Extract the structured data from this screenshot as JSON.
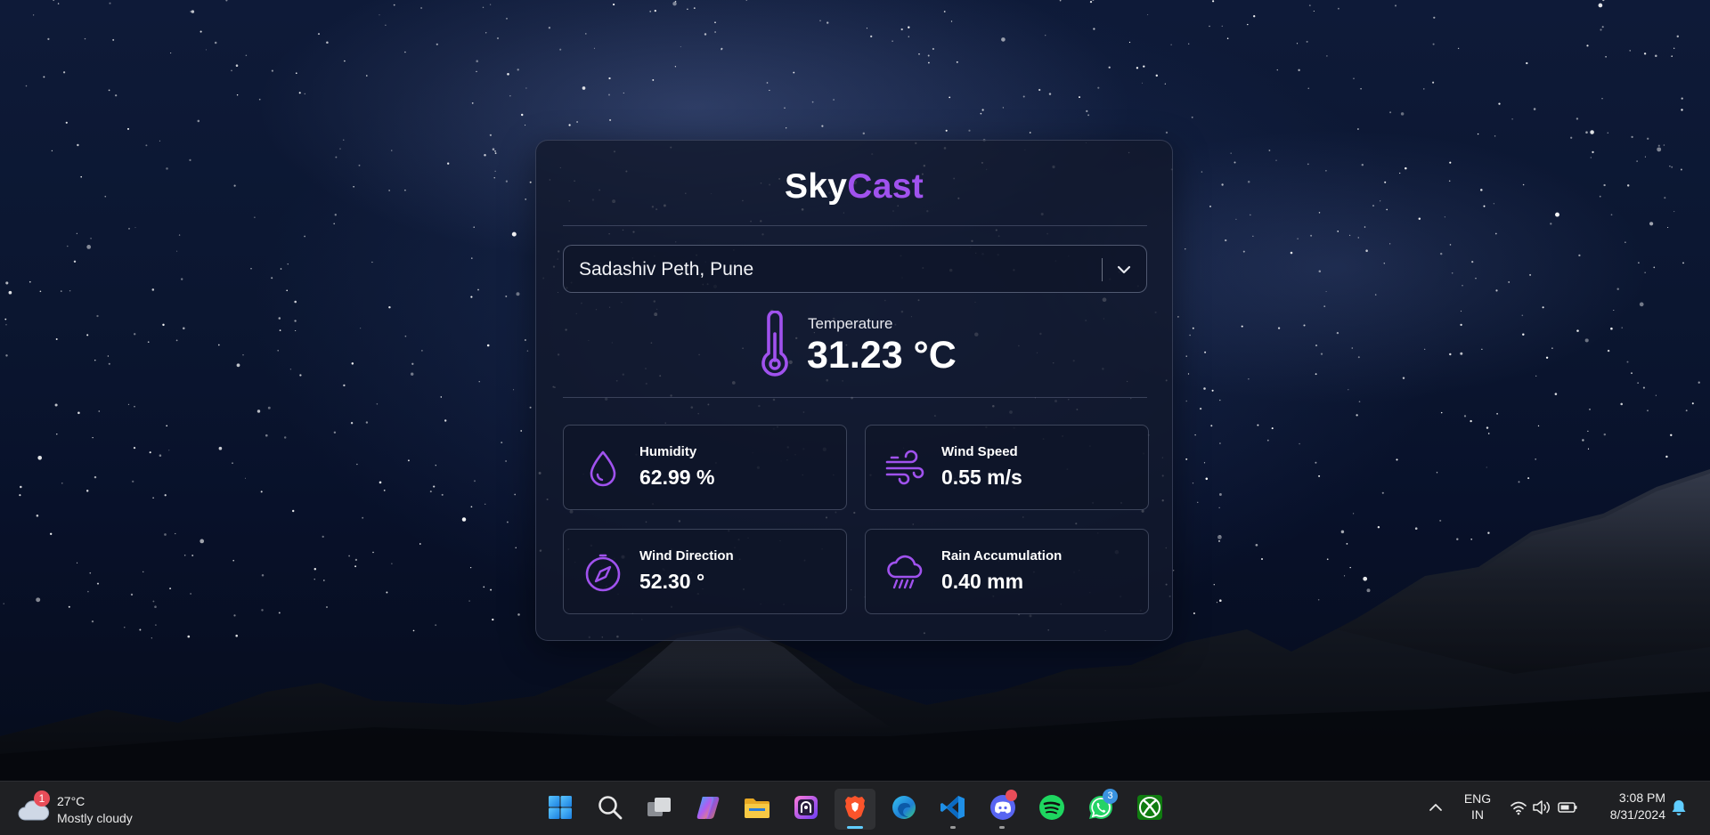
{
  "app": {
    "brand_part1": "Sky",
    "brand_part2": "Cast",
    "location_value": "Sadashiv Peth, Pune",
    "temperature": {
      "label": "Temperature",
      "value": "31.23 °C"
    },
    "metrics": [
      {
        "label": "Humidity",
        "value": "62.99 %",
        "icon": "droplet-icon"
      },
      {
        "label": "Wind Speed",
        "value": "0.55 m/s",
        "icon": "wind-icon"
      },
      {
        "label": "Wind Direction",
        "value": "52.30 °",
        "icon": "compass-icon"
      },
      {
        "label": "Rain Accumulation",
        "value": "0.40 mm",
        "icon": "rain-cloud-icon"
      }
    ],
    "accent_color": "#a052ee"
  },
  "taskbar": {
    "weather_widget": {
      "badge": "1",
      "temp": "27°C",
      "desc": "Mostly cloudy"
    },
    "apps": [
      "start-icon",
      "search-icon",
      "task-view-icon",
      "copilot-icon",
      "file-explorer-icon",
      "proton-pass-icon",
      "brave-icon",
      "edge-icon",
      "vscode-icon",
      "discord-icon",
      "spotify-icon",
      "whatsapp-icon",
      "xbox-icon"
    ],
    "whatsapp_badge": "3",
    "lang_line1": "ENG",
    "lang_line2": "IN",
    "time": "3:08 PM",
    "date": "8/31/2024"
  }
}
